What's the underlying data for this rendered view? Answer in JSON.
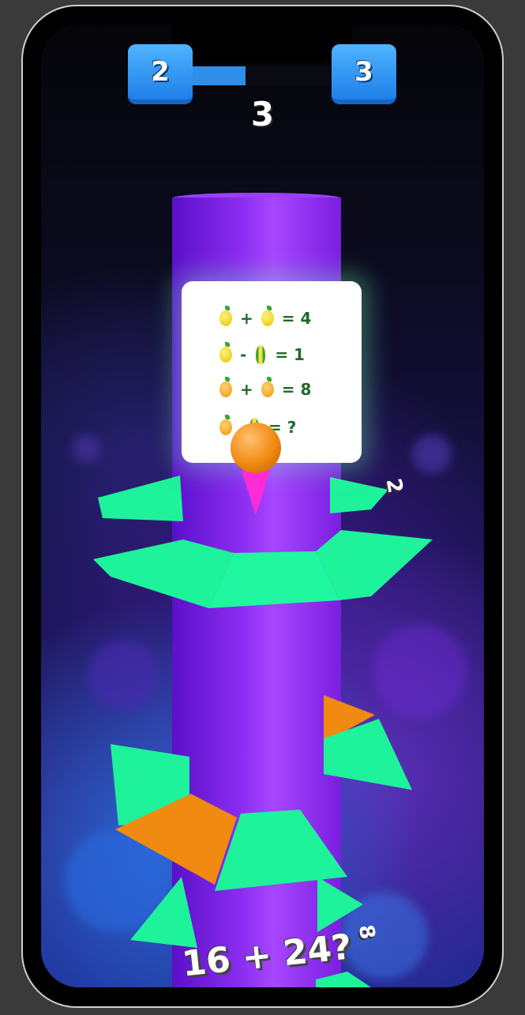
{
  "hud": {
    "current_level": "2",
    "next_level": "3",
    "level_progress": 0.38,
    "score": "3"
  },
  "puzzle_card": {
    "rows": [
      {
        "items": [
          "lemon",
          "+",
          "lemon"
        ],
        "result": "= 4"
      },
      {
        "items": [
          "lemon",
          "-",
          "corn"
        ],
        "result": "= 1"
      },
      {
        "items": [
          "orange",
          "+",
          "orange"
        ],
        "result": "= 8"
      },
      {
        "items": [
          "orange",
          "",
          "corn"
        ],
        "result": "= ?"
      }
    ]
  },
  "bottom_question": "16 + 24?",
  "side_labels": [
    "2",
    "8"
  ],
  "colors": {
    "tower": "#8a2cf0",
    "platform_safe": "#1ef29a",
    "platform_hazard": "#f08a10",
    "ball": "#f08a10",
    "trail": "#ff2bd6",
    "badge": "#2f8ee8"
  }
}
